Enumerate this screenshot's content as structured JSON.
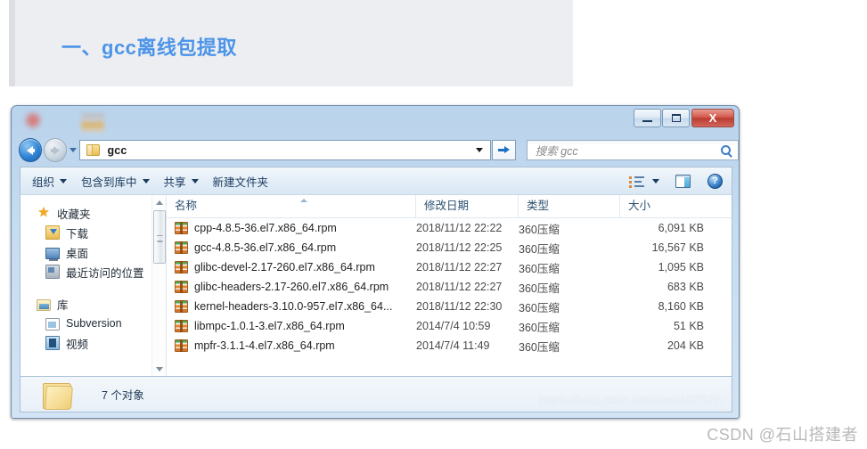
{
  "article": {
    "heading": "一、gcc离线包提取"
  },
  "window": {
    "title": "gcc",
    "controls": {
      "minimize_label": "最小化",
      "maximize_label": "最大化",
      "close_label": "X"
    }
  },
  "address_bar": {
    "path_text": "gcc",
    "folder_icon": "folder-icon",
    "back_icon": "back-arrow-icon",
    "forward_icon": "forward-arrow-icon",
    "history_icon": "chevron-down-icon",
    "dropdown_icon": "chevron-down-icon",
    "go_icon": "go-arrow-icon"
  },
  "search": {
    "placeholder": "搜索 gcc",
    "icon": "search-icon"
  },
  "toolbar": {
    "items": [
      {
        "label": "组织",
        "has_caret": true
      },
      {
        "label": "包含到库中",
        "has_caret": true
      },
      {
        "label": "共享",
        "has_caret": true
      },
      {
        "label": "新建文件夹",
        "has_caret": false
      }
    ],
    "view_mode_icon": "list-view-icon",
    "view_mode_caret": "chevron-down-icon",
    "preview_pane_icon": "preview-pane-icon",
    "help_icon": "help-icon",
    "help_glyph": "?"
  },
  "nav_pane": {
    "items": [
      {
        "label": "收藏夹",
        "icon": "star-icon",
        "level": 0
      },
      {
        "label": "下载",
        "icon": "download-folder-icon",
        "level": 1
      },
      {
        "label": "桌面",
        "icon": "desktop-icon",
        "level": 1
      },
      {
        "label": "最近访问的位置",
        "icon": "recent-places-icon",
        "level": 1
      },
      {
        "label": "库",
        "icon": "library-icon",
        "level": 0
      },
      {
        "label": "Subversion",
        "icon": "document-library-icon",
        "level": 1
      },
      {
        "label": "视频",
        "icon": "video-library-icon",
        "level": 1
      }
    ],
    "scrollbar": {
      "up_icon": "scroll-up-arrow-icon",
      "down_icon": "scroll-down-arrow-icon"
    }
  },
  "file_list": {
    "columns": [
      "名称",
      "修改日期",
      "类型",
      "大小"
    ],
    "sort_column": "名称",
    "sort_direction": "ascending",
    "rows": [
      {
        "name": "cpp-4.8.5-36.el7.x86_64.rpm",
        "date": "2018/11/12 22:22",
        "type": "360压缩",
        "size": "6,091 KB",
        "icon": "archive-icon"
      },
      {
        "name": "gcc-4.8.5-36.el7.x86_64.rpm",
        "date": "2018/11/12 22:25",
        "type": "360压缩",
        "size": "16,567 KB",
        "icon": "archive-icon"
      },
      {
        "name": "glibc-devel-2.17-260.el7.x86_64.rpm",
        "date": "2018/11/12 22:27",
        "type": "360压缩",
        "size": "1,095 KB",
        "icon": "archive-icon"
      },
      {
        "name": "glibc-headers-2.17-260.el7.x86_64.rpm",
        "date": "2018/11/12 22:27",
        "type": "360压缩",
        "size": "683 KB",
        "icon": "archive-icon"
      },
      {
        "name": "kernel-headers-3.10.0-957.el7.x86_64...",
        "date": "2018/11/12 22:30",
        "type": "360压缩",
        "size": "8,160 KB",
        "icon": "archive-icon"
      },
      {
        "name": "libmpc-1.0.1-3.el7.x86_64.rpm",
        "date": "2014/7/4 10:59",
        "type": "360压缩",
        "size": "51 KB",
        "icon": "archive-icon"
      },
      {
        "name": "mpfr-3.1.1-4.el7.x86_64.rpm",
        "date": "2014/7/4 11:49",
        "type": "360压缩",
        "size": "204 KB",
        "icon": "archive-icon"
      }
    ]
  },
  "status_bar": {
    "text": "7 个对象",
    "folder_icon": "folder-icon"
  },
  "watermarks": {
    "inner": "https://blog.csdn.net/zhan107876",
    "outer": "CSDN @石山搭建者"
  },
  "colors": {
    "heading_accent": "#4d94e8",
    "heading_bg": "#eceef2",
    "window_frame": "#b9d3ec",
    "close_button": "#c04a3c"
  }
}
